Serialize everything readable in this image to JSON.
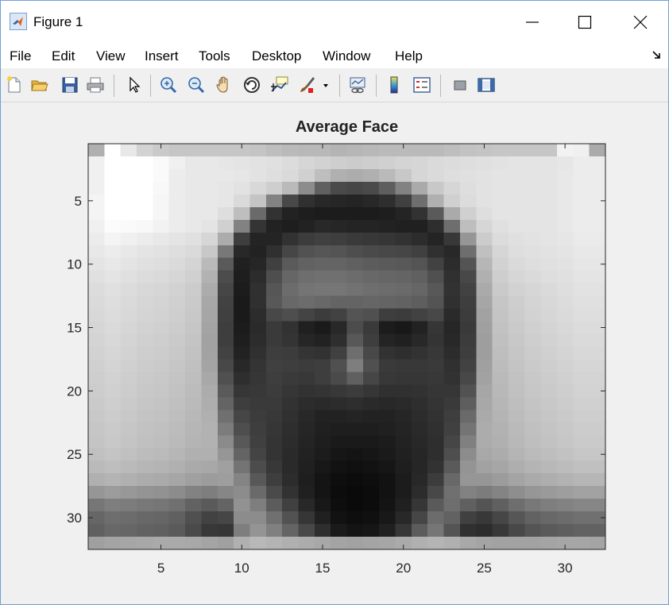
{
  "window": {
    "title": "Figure 1",
    "controls": {
      "minimize": "minimize",
      "maximize": "maximize",
      "close": "close"
    }
  },
  "menu": [
    "File",
    "Edit",
    "View",
    "Insert",
    "Tools",
    "Desktop",
    "Window",
    "Help"
  ],
  "toolbar": [
    {
      "icon": "new-figure-icon"
    },
    {
      "icon": "open-file-icon"
    },
    {
      "icon": "save-icon"
    },
    {
      "icon": "print-icon"
    },
    {
      "icon": "select-arrow-icon"
    },
    {
      "icon": "zoom-in-icon"
    },
    {
      "icon": "zoom-out-icon"
    },
    {
      "icon": "pan-hand-icon"
    },
    {
      "icon": "rotate-3d-icon"
    },
    {
      "icon": "data-cursor-icon"
    },
    {
      "icon": "brush-icon"
    },
    {
      "icon": "brush-dropdown-icon"
    },
    {
      "icon": "link-plot-icon"
    },
    {
      "icon": "colorbar-icon"
    },
    {
      "icon": "legend-icon"
    },
    {
      "icon": "hide-plot-tools-icon"
    },
    {
      "icon": "show-plot-tools-icon"
    }
  ],
  "chart_data": {
    "type": "heatmap",
    "title": "Average Face",
    "colormap": "gray",
    "size": [
      32,
      32
    ],
    "xlim": [
      0.5,
      32.5
    ],
    "ylim": [
      0.5,
      32.5
    ],
    "y_reversed": true,
    "xticks": [
      5,
      10,
      15,
      20,
      25,
      30
    ],
    "yticks": [
      5,
      10,
      15,
      20,
      25,
      30
    ],
    "values": [
      [
        176,
        255,
        232,
        211,
        202,
        198,
        198,
        198,
        198,
        198,
        196,
        190,
        186,
        184,
        184,
        180,
        182,
        184,
        186,
        186,
        186,
        186,
        190,
        194,
        196,
        198,
        198,
        198,
        198,
        242,
        240,
        170
      ],
      [
        240,
        255,
        255,
        255,
        250,
        240,
        232,
        232,
        230,
        228,
        226,
        224,
        220,
        214,
        210,
        206,
        204,
        206,
        208,
        212,
        214,
        218,
        220,
        222,
        224,
        226,
        228,
        228,
        228,
        230,
        236,
        236
      ],
      [
        240,
        255,
        255,
        255,
        250,
        236,
        232,
        232,
        232,
        230,
        226,
        222,
        218,
        208,
        190,
        176,
        172,
        176,
        186,
        200,
        214,
        218,
        222,
        224,
        226,
        228,
        228,
        228,
        228,
        232,
        236,
        236
      ],
      [
        240,
        255,
        255,
        255,
        248,
        236,
        232,
        232,
        230,
        226,
        216,
        206,
        186,
        140,
        96,
        74,
        70,
        74,
        94,
        130,
        170,
        200,
        214,
        222,
        226,
        228,
        228,
        228,
        228,
        232,
        236,
        236
      ],
      [
        244,
        255,
        255,
        255,
        246,
        236,
        232,
        232,
        230,
        218,
        196,
        130,
        72,
        48,
        40,
        38,
        36,
        40,
        46,
        64,
        110,
        176,
        208,
        220,
        226,
        228,
        228,
        228,
        228,
        232,
        236,
        236
      ],
      [
        244,
        255,
        255,
        255,
        246,
        236,
        232,
        232,
        222,
        190,
        106,
        50,
        34,
        30,
        28,
        28,
        28,
        28,
        30,
        36,
        50,
        90,
        170,
        208,
        222,
        228,
        228,
        228,
        228,
        232,
        236,
        236
      ],
      [
        240,
        252,
        250,
        248,
        242,
        236,
        232,
        228,
        208,
        130,
        52,
        34,
        30,
        34,
        40,
        38,
        36,
        36,
        34,
        32,
        32,
        46,
        110,
        190,
        214,
        224,
        228,
        228,
        228,
        232,
        236,
        236
      ],
      [
        236,
        244,
        240,
        236,
        232,
        228,
        224,
        214,
        172,
        62,
        36,
        36,
        50,
        60,
        64,
        62,
        58,
        56,
        54,
        50,
        44,
        36,
        56,
        150,
        204,
        220,
        224,
        226,
        228,
        230,
        234,
        234
      ],
      [
        232,
        236,
        232,
        228,
        226,
        222,
        218,
        200,
        120,
        40,
        34,
        48,
        70,
        82,
        86,
        84,
        78,
        74,
        72,
        70,
        64,
        48,
        40,
        110,
        192,
        214,
        222,
        224,
        226,
        228,
        232,
        232
      ],
      [
        228,
        232,
        228,
        224,
        222,
        218,
        212,
        186,
        90,
        32,
        38,
        64,
        90,
        98,
        100,
        100,
        96,
        92,
        90,
        88,
        84,
        66,
        44,
        84,
        182,
        210,
        218,
        222,
        224,
        226,
        230,
        230
      ],
      [
        224,
        228,
        224,
        220,
        218,
        214,
        208,
        178,
        76,
        30,
        44,
        78,
        102,
        110,
        112,
        112,
        108,
        104,
        102,
        100,
        96,
        80,
        48,
        72,
        176,
        206,
        214,
        218,
        222,
        224,
        228,
        228
      ],
      [
        220,
        224,
        220,
        216,
        214,
        210,
        204,
        172,
        70,
        28,
        48,
        86,
        108,
        116,
        118,
        118,
        114,
        110,
        108,
        106,
        102,
        88,
        50,
        66,
        170,
        202,
        210,
        214,
        218,
        222,
        226,
        226
      ],
      [
        218,
        222,
        218,
        214,
        212,
        208,
        202,
        168,
        66,
        26,
        48,
        88,
        104,
        108,
        104,
        100,
        100,
        102,
        100,
        98,
        94,
        84,
        48,
        62,
        166,
        198,
        206,
        212,
        216,
        220,
        224,
        224
      ],
      [
        216,
        220,
        216,
        212,
        210,
        206,
        200,
        166,
        64,
        26,
        44,
        72,
        78,
        68,
        60,
        66,
        84,
        80,
        62,
        60,
        66,
        72,
        42,
        60,
        162,
        196,
        204,
        210,
        214,
        218,
        222,
        222
      ],
      [
        214,
        218,
        214,
        210,
        208,
        204,
        198,
        164,
        62,
        28,
        42,
        58,
        50,
        32,
        26,
        40,
        76,
        58,
        28,
        24,
        34,
        54,
        38,
        58,
        160,
        194,
        202,
        208,
        212,
        216,
        220,
        220
      ],
      [
        212,
        216,
        212,
        208,
        206,
        202,
        196,
        162,
        62,
        30,
        44,
        58,
        52,
        38,
        34,
        46,
        88,
        62,
        36,
        32,
        40,
        52,
        40,
        60,
        158,
        192,
        200,
        206,
        210,
        214,
        218,
        218
      ],
      [
        210,
        214,
        210,
        206,
        204,
        200,
        194,
        162,
        66,
        34,
        48,
        62,
        60,
        52,
        50,
        64,
        110,
        72,
        50,
        46,
        50,
        56,
        44,
        62,
        158,
        190,
        198,
        204,
        208,
        212,
        216,
        216
      ],
      [
        208,
        212,
        208,
        204,
        202,
        198,
        192,
        164,
        72,
        40,
        52,
        64,
        62,
        60,
        62,
        80,
        126,
        80,
        58,
        56,
        56,
        58,
        48,
        66,
        160,
        188,
        196,
        202,
        206,
        210,
        214,
        214
      ],
      [
        206,
        210,
        206,
        202,
        200,
        196,
        190,
        168,
        80,
        46,
        54,
        62,
        58,
        56,
        62,
        74,
        96,
        70,
        56,
        54,
        54,
        56,
        50,
        72,
        162,
        186,
        194,
        200,
        204,
        208,
        212,
        212
      ],
      [
        204,
        208,
        204,
        200,
        198,
        194,
        188,
        172,
        90,
        54,
        56,
        60,
        54,
        50,
        52,
        56,
        60,
        54,
        48,
        48,
        50,
        54,
        54,
        82,
        166,
        184,
        192,
        198,
        202,
        206,
        210,
        210
      ],
      [
        202,
        206,
        202,
        198,
        196,
        192,
        186,
        174,
        100,
        62,
        58,
        58,
        50,
        44,
        42,
        44,
        46,
        42,
        40,
        42,
        46,
        52,
        58,
        94,
        168,
        182,
        190,
        196,
        200,
        204,
        208,
        208
      ],
      [
        200,
        204,
        200,
        196,
        194,
        190,
        184,
        176,
        112,
        70,
        60,
        56,
        48,
        40,
        34,
        34,
        36,
        34,
        34,
        38,
        44,
        50,
        62,
        106,
        170,
        180,
        188,
        194,
        198,
        202,
        206,
        206
      ],
      [
        198,
        202,
        198,
        194,
        192,
        188,
        182,
        178,
        124,
        78,
        62,
        54,
        46,
        38,
        32,
        30,
        30,
        30,
        32,
        36,
        42,
        48,
        64,
        116,
        172,
        178,
        186,
        192,
        196,
        200,
        204,
        204
      ],
      [
        196,
        200,
        196,
        192,
        190,
        186,
        180,
        178,
        138,
        88,
        64,
        52,
        44,
        36,
        30,
        26,
        26,
        26,
        28,
        34,
        40,
        46,
        70,
        128,
        172,
        176,
        184,
        190,
        194,
        198,
        202,
        202
      ],
      [
        192,
        196,
        192,
        188,
        186,
        182,
        176,
        176,
        150,
        100,
        68,
        52,
        42,
        34,
        28,
        22,
        20,
        22,
        26,
        32,
        38,
        46,
        78,
        140,
        168,
        172,
        180,
        186,
        190,
        194,
        198,
        198
      ],
      [
        186,
        190,
        186,
        182,
        180,
        176,
        170,
        168,
        160,
        116,
        76,
        56,
        42,
        32,
        24,
        18,
        16,
        18,
        22,
        30,
        38,
        50,
        90,
        148,
        162,
        166,
        174,
        180,
        184,
        188,
        192,
        192
      ],
      [
        176,
        180,
        176,
        172,
        170,
        166,
        160,
        156,
        158,
        132,
        88,
        62,
        44,
        30,
        20,
        14,
        12,
        14,
        18,
        28,
        40,
        60,
        104,
        150,
        150,
        156,
        164,
        170,
        174,
        178,
        182,
        182
      ],
      [
        150,
        156,
        152,
        148,
        146,
        140,
        130,
        126,
        134,
        140,
        106,
        74,
        50,
        32,
        20,
        12,
        10,
        12,
        18,
        28,
        44,
        72,
        112,
        130,
        124,
        132,
        142,
        150,
        154,
        158,
        162,
        162
      ],
      [
        118,
        126,
        124,
        120,
        118,
        112,
        98,
        90,
        100,
        146,
        126,
        92,
        64,
        40,
        24,
        14,
        10,
        12,
        20,
        32,
        54,
        90,
        110,
        96,
        84,
        96,
        110,
        120,
        126,
        130,
        134,
        134
      ],
      [
        102,
        110,
        108,
        104,
        102,
        96,
        80,
        66,
        70,
        140,
        140,
        112,
        82,
        54,
        32,
        18,
        14,
        16,
        24,
        40,
        70,
        108,
        98,
        64,
        56,
        70,
        86,
        98,
        104,
        108,
        112,
        112
      ],
      [
        96,
        104,
        102,
        98,
        96,
        90,
        74,
        56,
        54,
        126,
        148,
        128,
        100,
        72,
        46,
        26,
        20,
        22,
        32,
        54,
        92,
        118,
        84,
        48,
        44,
        56,
        72,
        84,
        90,
        94,
        98,
        98
      ],
      [
        160,
        164,
        166,
        168,
        170,
        170,
        168,
        164,
        160,
        176,
        184,
        180,
        176,
        172,
        168,
        164,
        162,
        164,
        166,
        170,
        176,
        180,
        176,
        168,
        164,
        162,
        162,
        162,
        164,
        166,
        166,
        164
      ]
    ]
  }
}
